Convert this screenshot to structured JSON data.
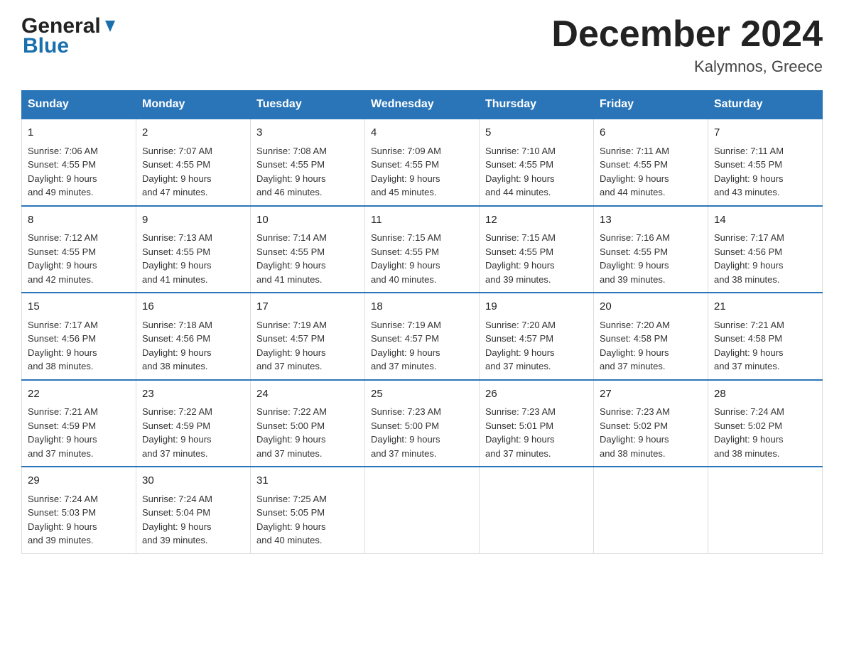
{
  "header": {
    "logo_line1": "General",
    "logo_line2": "Blue",
    "title": "December 2024",
    "subtitle": "Kalymnos, Greece"
  },
  "weekdays": [
    "Sunday",
    "Monday",
    "Tuesday",
    "Wednesday",
    "Thursday",
    "Friday",
    "Saturday"
  ],
  "weeks": [
    [
      {
        "day": "1",
        "sunrise": "7:06 AM",
        "sunset": "4:55 PM",
        "daylight": "9 hours and 49 minutes."
      },
      {
        "day": "2",
        "sunrise": "7:07 AM",
        "sunset": "4:55 PM",
        "daylight": "9 hours and 47 minutes."
      },
      {
        "day": "3",
        "sunrise": "7:08 AM",
        "sunset": "4:55 PM",
        "daylight": "9 hours and 46 minutes."
      },
      {
        "day": "4",
        "sunrise": "7:09 AM",
        "sunset": "4:55 PM",
        "daylight": "9 hours and 45 minutes."
      },
      {
        "day": "5",
        "sunrise": "7:10 AM",
        "sunset": "4:55 PM",
        "daylight": "9 hours and 44 minutes."
      },
      {
        "day": "6",
        "sunrise": "7:11 AM",
        "sunset": "4:55 PM",
        "daylight": "9 hours and 44 minutes."
      },
      {
        "day": "7",
        "sunrise": "7:11 AM",
        "sunset": "4:55 PM",
        "daylight": "9 hours and 43 minutes."
      }
    ],
    [
      {
        "day": "8",
        "sunrise": "7:12 AM",
        "sunset": "4:55 PM",
        "daylight": "9 hours and 42 minutes."
      },
      {
        "day": "9",
        "sunrise": "7:13 AM",
        "sunset": "4:55 PM",
        "daylight": "9 hours and 41 minutes."
      },
      {
        "day": "10",
        "sunrise": "7:14 AM",
        "sunset": "4:55 PM",
        "daylight": "9 hours and 41 minutes."
      },
      {
        "day": "11",
        "sunrise": "7:15 AM",
        "sunset": "4:55 PM",
        "daylight": "9 hours and 40 minutes."
      },
      {
        "day": "12",
        "sunrise": "7:15 AM",
        "sunset": "4:55 PM",
        "daylight": "9 hours and 39 minutes."
      },
      {
        "day": "13",
        "sunrise": "7:16 AM",
        "sunset": "4:55 PM",
        "daylight": "9 hours and 39 minutes."
      },
      {
        "day": "14",
        "sunrise": "7:17 AM",
        "sunset": "4:56 PM",
        "daylight": "9 hours and 38 minutes."
      }
    ],
    [
      {
        "day": "15",
        "sunrise": "7:17 AM",
        "sunset": "4:56 PM",
        "daylight": "9 hours and 38 minutes."
      },
      {
        "day": "16",
        "sunrise": "7:18 AM",
        "sunset": "4:56 PM",
        "daylight": "9 hours and 38 minutes."
      },
      {
        "day": "17",
        "sunrise": "7:19 AM",
        "sunset": "4:57 PM",
        "daylight": "9 hours and 37 minutes."
      },
      {
        "day": "18",
        "sunrise": "7:19 AM",
        "sunset": "4:57 PM",
        "daylight": "9 hours and 37 minutes."
      },
      {
        "day": "19",
        "sunrise": "7:20 AM",
        "sunset": "4:57 PM",
        "daylight": "9 hours and 37 minutes."
      },
      {
        "day": "20",
        "sunrise": "7:20 AM",
        "sunset": "4:58 PM",
        "daylight": "9 hours and 37 minutes."
      },
      {
        "day": "21",
        "sunrise": "7:21 AM",
        "sunset": "4:58 PM",
        "daylight": "9 hours and 37 minutes."
      }
    ],
    [
      {
        "day": "22",
        "sunrise": "7:21 AM",
        "sunset": "4:59 PM",
        "daylight": "9 hours and 37 minutes."
      },
      {
        "day": "23",
        "sunrise": "7:22 AM",
        "sunset": "4:59 PM",
        "daylight": "9 hours and 37 minutes."
      },
      {
        "day": "24",
        "sunrise": "7:22 AM",
        "sunset": "5:00 PM",
        "daylight": "9 hours and 37 minutes."
      },
      {
        "day": "25",
        "sunrise": "7:23 AM",
        "sunset": "5:00 PM",
        "daylight": "9 hours and 37 minutes."
      },
      {
        "day": "26",
        "sunrise": "7:23 AM",
        "sunset": "5:01 PM",
        "daylight": "9 hours and 37 minutes."
      },
      {
        "day": "27",
        "sunrise": "7:23 AM",
        "sunset": "5:02 PM",
        "daylight": "9 hours and 38 minutes."
      },
      {
        "day": "28",
        "sunrise": "7:24 AM",
        "sunset": "5:02 PM",
        "daylight": "9 hours and 38 minutes."
      }
    ],
    [
      {
        "day": "29",
        "sunrise": "7:24 AM",
        "sunset": "5:03 PM",
        "daylight": "9 hours and 39 minutes."
      },
      {
        "day": "30",
        "sunrise": "7:24 AM",
        "sunset": "5:04 PM",
        "daylight": "9 hours and 39 minutes."
      },
      {
        "day": "31",
        "sunrise": "7:25 AM",
        "sunset": "5:05 PM",
        "daylight": "9 hours and 40 minutes."
      },
      null,
      null,
      null,
      null
    ]
  ]
}
